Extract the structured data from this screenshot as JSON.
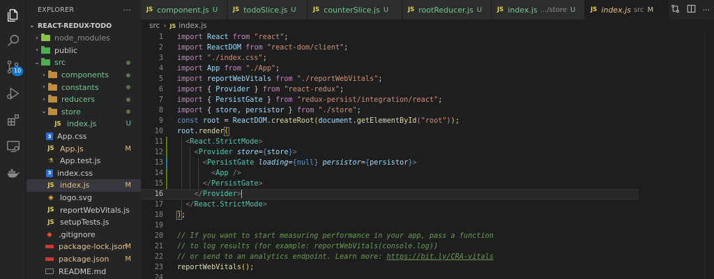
{
  "activity": {
    "badge": "10"
  },
  "explorer": {
    "title": "EXPLORER",
    "more": "···",
    "root": "REACT-REDUX-TODO",
    "items": [
      {
        "label": "node_modules",
        "status": ""
      },
      {
        "label": "public",
        "status": ""
      },
      {
        "label": "src",
        "status": ""
      },
      {
        "label": "components",
        "status": ""
      },
      {
        "label": "constants",
        "status": ""
      },
      {
        "label": "reducers",
        "status": ""
      },
      {
        "label": "store",
        "status": ""
      },
      {
        "label": "index.js",
        "status": "U"
      },
      {
        "label": "App.css",
        "status": ""
      },
      {
        "label": "App.js",
        "status": "M"
      },
      {
        "label": "App.test.js",
        "status": ""
      },
      {
        "label": "index.css",
        "status": ""
      },
      {
        "label": "index.js",
        "status": "M"
      },
      {
        "label": "logo.svg",
        "status": ""
      },
      {
        "label": "reportWebVitals.js",
        "status": ""
      },
      {
        "label": "setupTests.js",
        "status": ""
      },
      {
        "label": ".gitignore",
        "status": ""
      },
      {
        "label": "package-lock.json",
        "status": "M"
      },
      {
        "label": "package.json",
        "status": "M"
      },
      {
        "label": "README.md",
        "status": ""
      }
    ]
  },
  "tabs": [
    {
      "icon": "JS",
      "name": "component.js",
      "sub": "",
      "status": "U"
    },
    {
      "icon": "JS",
      "name": "todoSlice.js",
      "sub": "",
      "status": "U"
    },
    {
      "icon": "JS",
      "name": "counterSlice.js",
      "sub": "",
      "status": "U"
    },
    {
      "icon": "JS",
      "name": "rootReducer.js",
      "sub": "",
      "status": "U"
    },
    {
      "icon": "JS",
      "name": "index.js",
      "sub": ".../store",
      "status": "U"
    },
    {
      "icon": "JS",
      "name": "index.js",
      "sub": "src",
      "status": "M"
    }
  ],
  "breadcrumb": {
    "folder": "src",
    "icon": "JS",
    "file": "index.js"
  },
  "editor": {
    "current_line": 16,
    "line_numbers": [
      "1",
      "2",
      "3",
      "4",
      "5",
      "6",
      "7",
      "8",
      "9",
      "10",
      "11",
      "12",
      "13",
      "14",
      "15",
      "16",
      "17",
      "18",
      "19",
      "20",
      "21",
      "22",
      "23",
      "24"
    ]
  },
  "colors": {
    "untracked": "#73c991",
    "modified": "#e2c08d",
    "badge": "#0e7ad3"
  }
}
